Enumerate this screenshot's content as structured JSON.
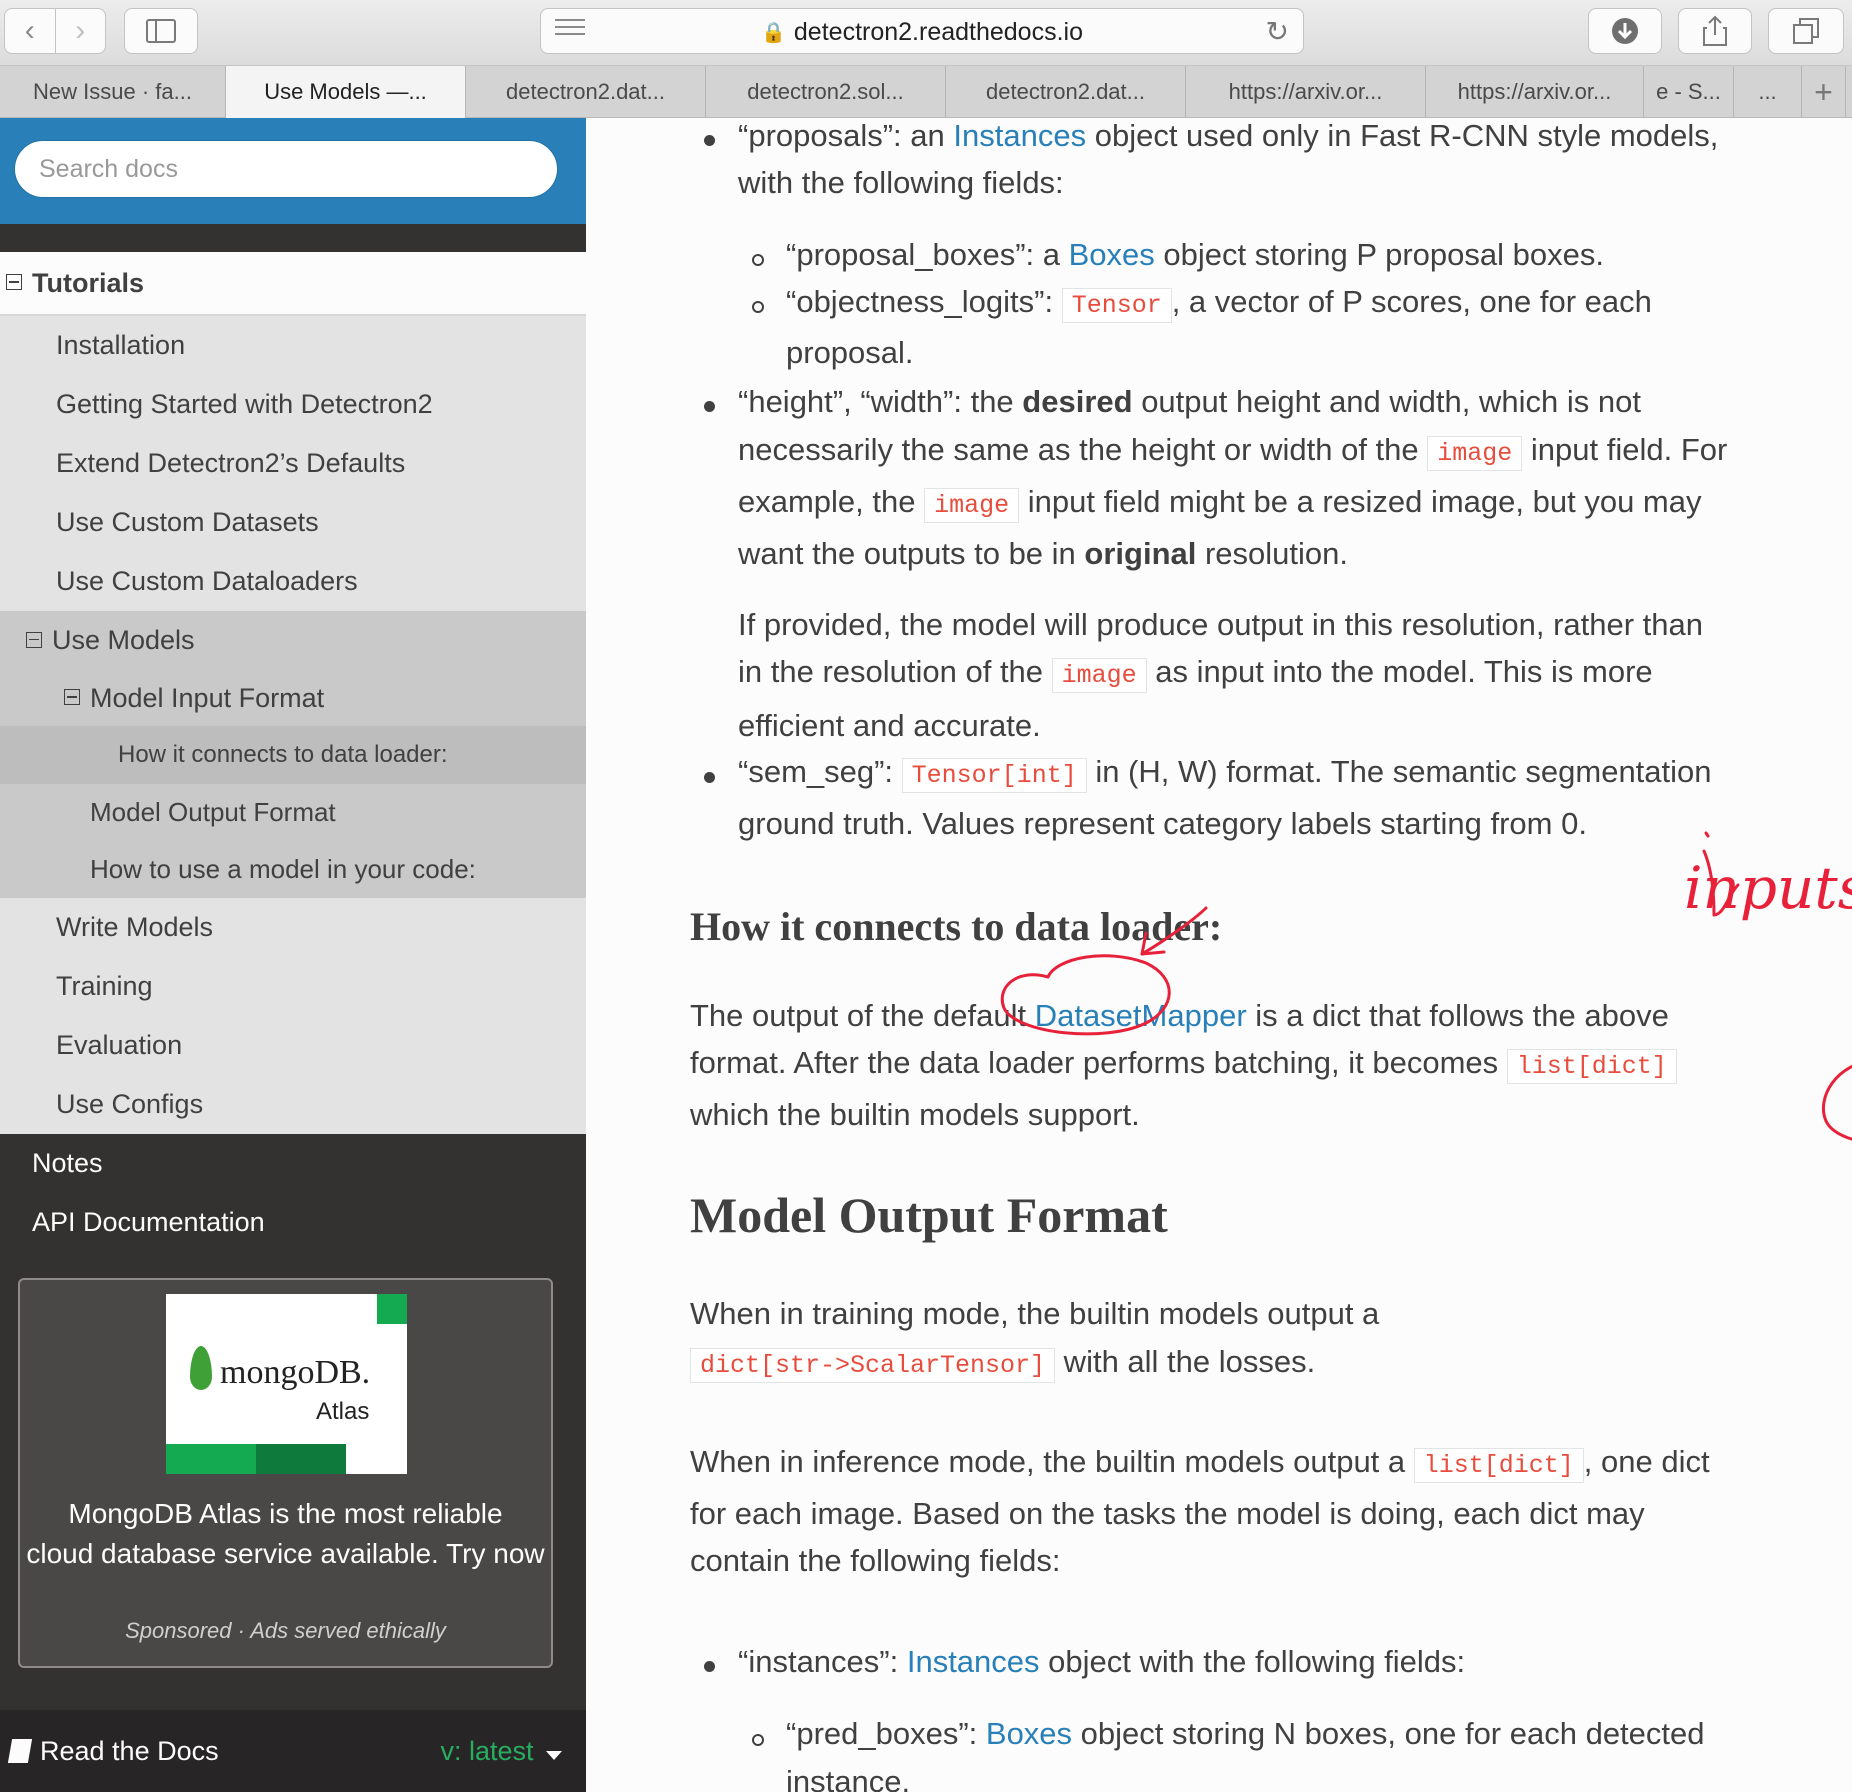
{
  "browser": {
    "url": "detectron2.readthedocs.io",
    "tabs": [
      "New Issue · fa...",
      "Use Models —...",
      "detectron2.dat...",
      "detectron2.sol...",
      "detectron2.dat...",
      "https://arxiv.or...",
      "https://arxiv.or...",
      "e - S...",
      "..."
    ]
  },
  "sidebar": {
    "search_placeholder": "Search docs",
    "nav": {
      "tutorials": "Tutorials",
      "installation": "Installation",
      "getting_started": "Getting Started with Detectron2",
      "extend_defaults": "Extend Detectron2’s Defaults",
      "custom_datasets": "Use Custom Datasets",
      "custom_dataloaders": "Use Custom Dataloaders",
      "use_models": "Use Models",
      "model_input_format": "Model Input Format",
      "connects_loader": "How it connects to data loader:",
      "model_output_format": "Model Output Format",
      "use_in_code": "How to use a model in your code:",
      "write_models": "Write Models",
      "training": "Training",
      "evaluation": "Evaluation",
      "use_configs": "Use Configs",
      "notes": "Notes",
      "api_docs": "API Documentation"
    },
    "ad": {
      "logo_word": "mongoDB.",
      "logo_sub": "Atlas",
      "text_line1": "MongoDB Atlas is the most reliable",
      "text_line2": "cloud database service available. Try now",
      "footer": "Sponsored · Ads served ethically"
    },
    "rtd": {
      "label": "Read the Docs",
      "version": "v: latest"
    }
  },
  "content": {
    "proposals": {
      "pre": "“proposals”: an ",
      "link": "Instances",
      "post": " object used only in Fast R-CNN style models,",
      "line2": "with the following fields:"
    },
    "proposal_boxes": {
      "pre": "“proposal_boxes”: a ",
      "link": "Boxes",
      "post": " object storing P proposal boxes."
    },
    "objectness": {
      "pre": "“objectness_logits”: ",
      "code": "Tensor",
      "post": ", a vector of P scores, one for each",
      "line2": "proposal."
    },
    "height_width": {
      "pre": "“height”, “width”: the ",
      "bold": "desired",
      "post": " output height and width, which is not",
      "l2_pre": "necessarily the same as the height or width of the ",
      "l2_code": "image",
      "l2_post": " input field. For",
      "l3_pre": "example, the ",
      "l3_code": "image",
      "l3_post": " input field might be a resized image, but you may",
      "l4_pre": "want the outputs to be in ",
      "l4_bold": "original",
      "l4_post": " resolution.",
      "p2_l1": "If provided, the model will produce output in this resolution, rather than",
      "p2_l2_pre": "in the resolution of the ",
      "p2_l2_code": "image",
      "p2_l2_post": " as input into the model. This is more",
      "p2_l3": "efficient and accurate."
    },
    "sem_seg": {
      "pre": "“sem_seg”: ",
      "code": "Tensor[int]",
      "post": " in (H, W) format. The semantic segmentation",
      "line2": "ground truth. Values represent category labels starting from 0."
    },
    "connects_heading": "How it connects to data loader:",
    "connects": {
      "l1_pre": "The output of the default ",
      "l1_link": "DatasetMapper",
      "l1_post": " is a dict that follows the above",
      "l2_pre": "format. After the data loader performs batching, it becomes ",
      "l2_code": "list[dict]",
      "l3": "which the builtin models support."
    },
    "output_heading": "Model Output Format",
    "training": {
      "l1": "When in training mode, the builtin models output a",
      "l2_code": "dict[str->ScalarTensor]",
      "l2_post": " with all the losses."
    },
    "inference": {
      "l1_pre": "When in inference mode, the builtin models output a ",
      "l1_code": "list[dict]",
      "l1_post": ", one dict",
      "l2": "for each image. Based on the tasks the model is doing, each dict may",
      "l3": "contain the following fields:"
    },
    "instances": {
      "pre": "“instances”: ",
      "link": "Instances",
      "post": " object with the following fields:"
    },
    "pred_boxes": {
      "pre": "“pred_boxes”: ",
      "link": "Boxes",
      "post": " object storing N boxes, one for each detected",
      "line2": "instance."
    }
  },
  "annotation": {
    "handwriting": "inputs ?",
    "ink_color": "#e8213a"
  }
}
